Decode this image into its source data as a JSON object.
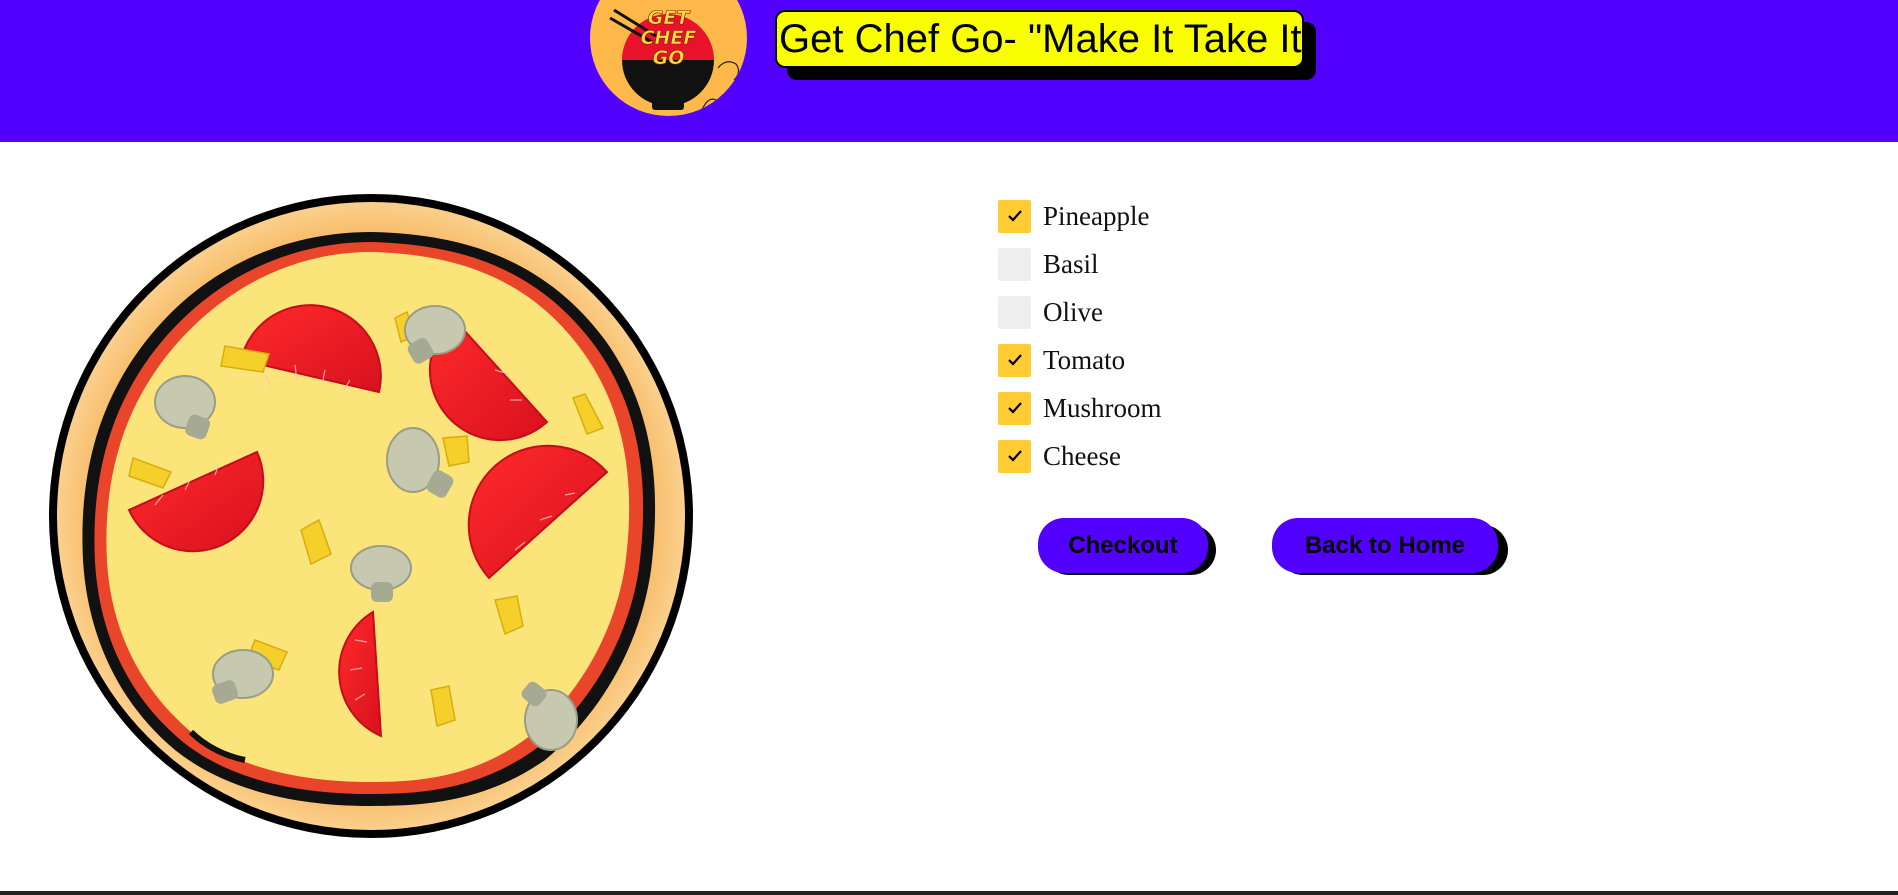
{
  "header": {
    "logo_lines": [
      "GET",
      "CHEF",
      "GO"
    ],
    "title": "Get Chef Go- \"Make It Take It\"",
    "background_color": "#5200ff",
    "title_background_color": "#faff00"
  },
  "pizza": {
    "icon": "pizza-illustration",
    "toppings_shown": [
      "pineapple",
      "tomato",
      "mushroom",
      "cheese"
    ]
  },
  "toppings": [
    {
      "label": "Pineapple",
      "checked": true
    },
    {
      "label": "Basil",
      "checked": false
    },
    {
      "label": "Olive",
      "checked": false
    },
    {
      "label": "Tomato",
      "checked": true
    },
    {
      "label": "Mushroom",
      "checked": true
    },
    {
      "label": "Cheese",
      "checked": true
    }
  ],
  "actions": {
    "checkout_label": "Checkout",
    "home_label": "Back to Home"
  },
  "colors": {
    "accent": "#5200ff",
    "checkbox_checked": "#ffcc33",
    "checkbox_unchecked": "#eeeeee"
  }
}
